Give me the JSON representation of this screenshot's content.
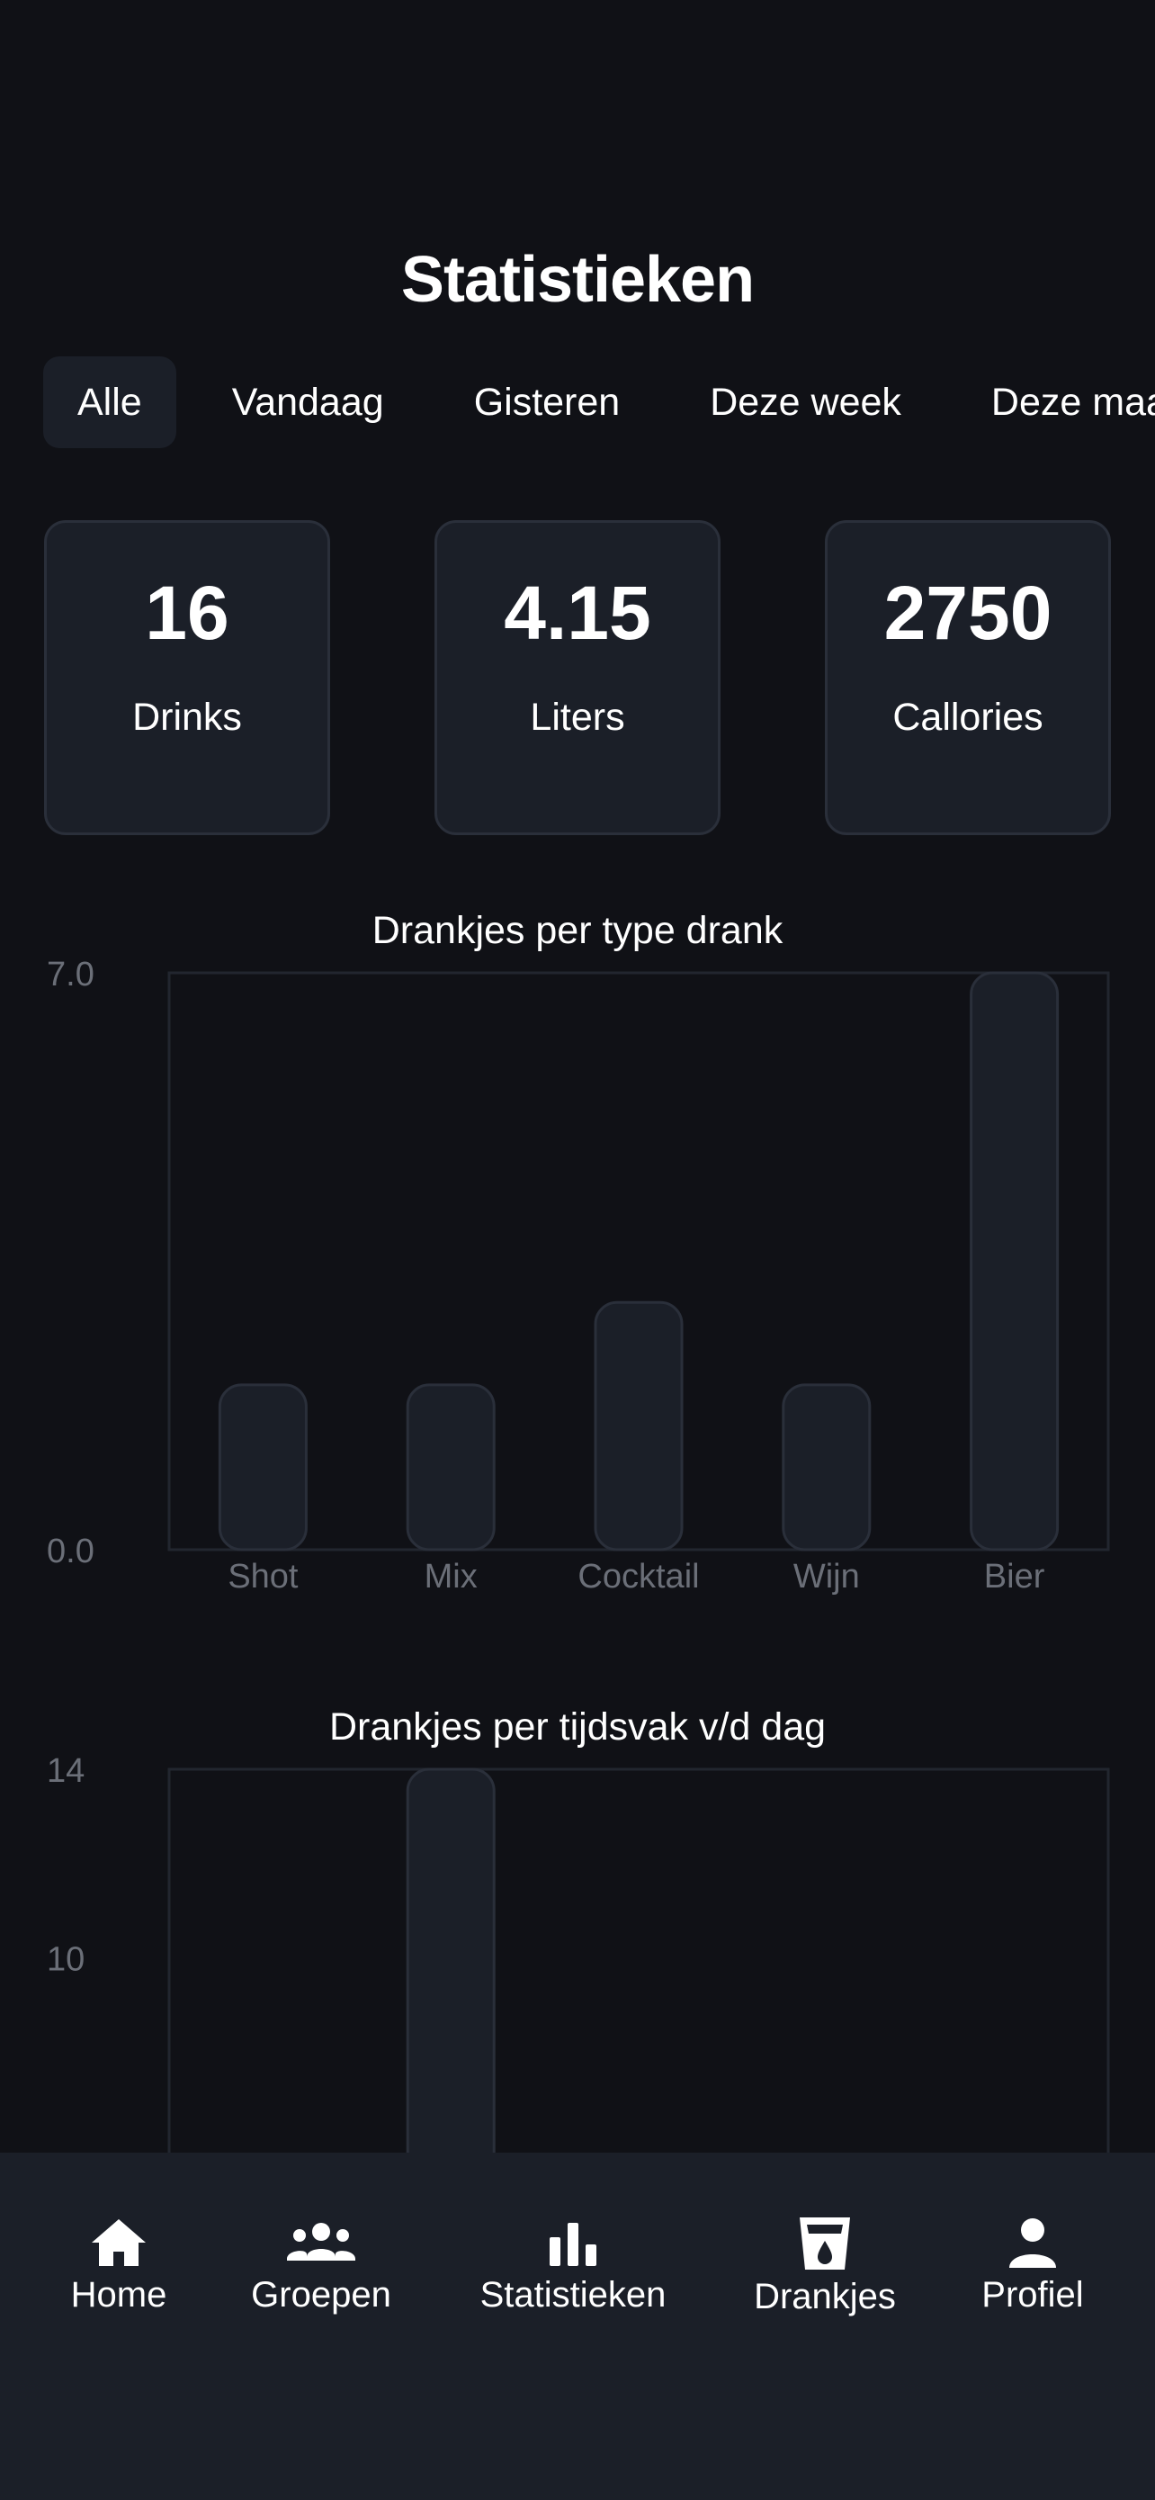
{
  "page": {
    "title": "Statistieken"
  },
  "filters": [
    "Alle",
    "Vandaag",
    "Gisteren",
    "Deze week",
    "Deze maand"
  ],
  "active_filter": "Alle",
  "stats": [
    {
      "value": "16",
      "label": "Drinks"
    },
    {
      "value": "4.15",
      "label": "Liters"
    },
    {
      "value": "2750",
      "label": "Callories"
    }
  ],
  "colors": {
    "background": "#101116",
    "card": "#1b1f28",
    "card_border": "#2a2f3a",
    "axis_text": "#6b6f78",
    "text": "#ffffff"
  },
  "chart_data": [
    {
      "type": "bar",
      "title": "Drankjes per type drank",
      "categories": [
        "Shot",
        "Mix",
        "Cocktail",
        "Wijn",
        "Bier"
      ],
      "values": [
        2,
        2,
        3,
        2,
        7
      ],
      "yticks": [
        "7.0",
        "0.0"
      ],
      "ylim": [
        0,
        7
      ],
      "grid": false
    },
    {
      "type": "bar",
      "title": "Drankjes per tijdsvak v/d dag",
      "categories": [
        "",
        "",
        "",
        "",
        ""
      ],
      "values": [
        0,
        14,
        0,
        0,
        0
      ],
      "yticks": [
        "14",
        "10"
      ],
      "ylim": [
        0,
        14
      ],
      "grid": false
    }
  ],
  "tabbar": {
    "items": [
      {
        "label": "Home",
        "icon": "home-icon"
      },
      {
        "label": "Groepen",
        "icon": "groups-icon"
      },
      {
        "label": "Statistieken",
        "icon": "bar-chart-icon"
      },
      {
        "label": "Drankjes",
        "icon": "glass-icon"
      },
      {
        "label": "Profiel",
        "icon": "person-icon"
      }
    ]
  }
}
